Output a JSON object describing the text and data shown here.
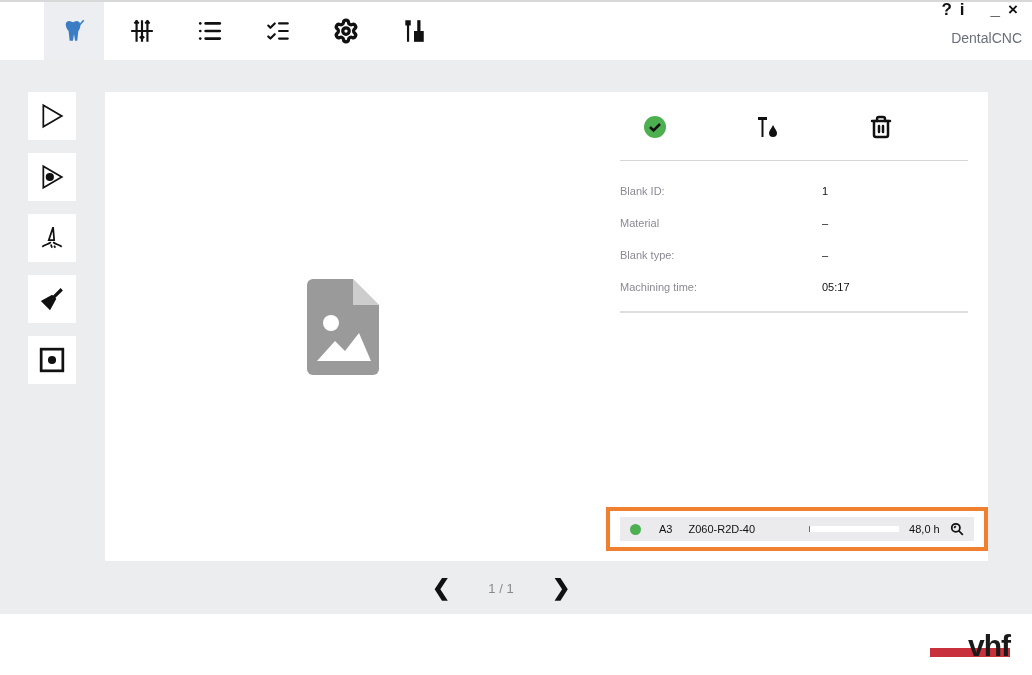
{
  "app": {
    "title": "DentalCNC",
    "controls": [
      {
        "kind": "help",
        "label": "?"
      },
      {
        "kind": "info",
        "label": "i"
      },
      {
        "kind": "minimize",
        "label": "_"
      },
      {
        "kind": "close",
        "label": "×"
      }
    ]
  },
  "tabs": [
    {
      "kind": "tooth",
      "selected": true
    },
    {
      "kind": "sliders",
      "selected": false
    },
    {
      "kind": "list",
      "selected": false
    },
    {
      "kind": "checklist",
      "selected": false
    },
    {
      "kind": "gear",
      "selected": false
    },
    {
      "kind": "tools",
      "selected": false
    }
  ],
  "side_actions": [
    {
      "kind": "play"
    },
    {
      "kind": "laser"
    },
    {
      "kind": "spray"
    },
    {
      "kind": "brush"
    },
    {
      "kind": "target"
    }
  ],
  "job": {
    "actions": [
      {
        "kind": "check"
      },
      {
        "kind": "tool-drop"
      },
      {
        "kind": "trash"
      }
    ],
    "details": [
      {
        "label": "Blank ID:",
        "value": "1"
      },
      {
        "label": "Material",
        "value": "–"
      },
      {
        "label": "Blank type:",
        "value": "–"
      },
      {
        "label": "Machining time:",
        "value": "05:17"
      }
    ],
    "blank": {
      "highlighted": true,
      "color": "#4caf50",
      "slot": "A3",
      "name": "Z060-R2D-40",
      "level": 0.01,
      "hours": "48,0 h"
    }
  },
  "pager": {
    "prev": "❮",
    "text": "1 / 1",
    "next": "❯"
  },
  "logo": "vhf"
}
